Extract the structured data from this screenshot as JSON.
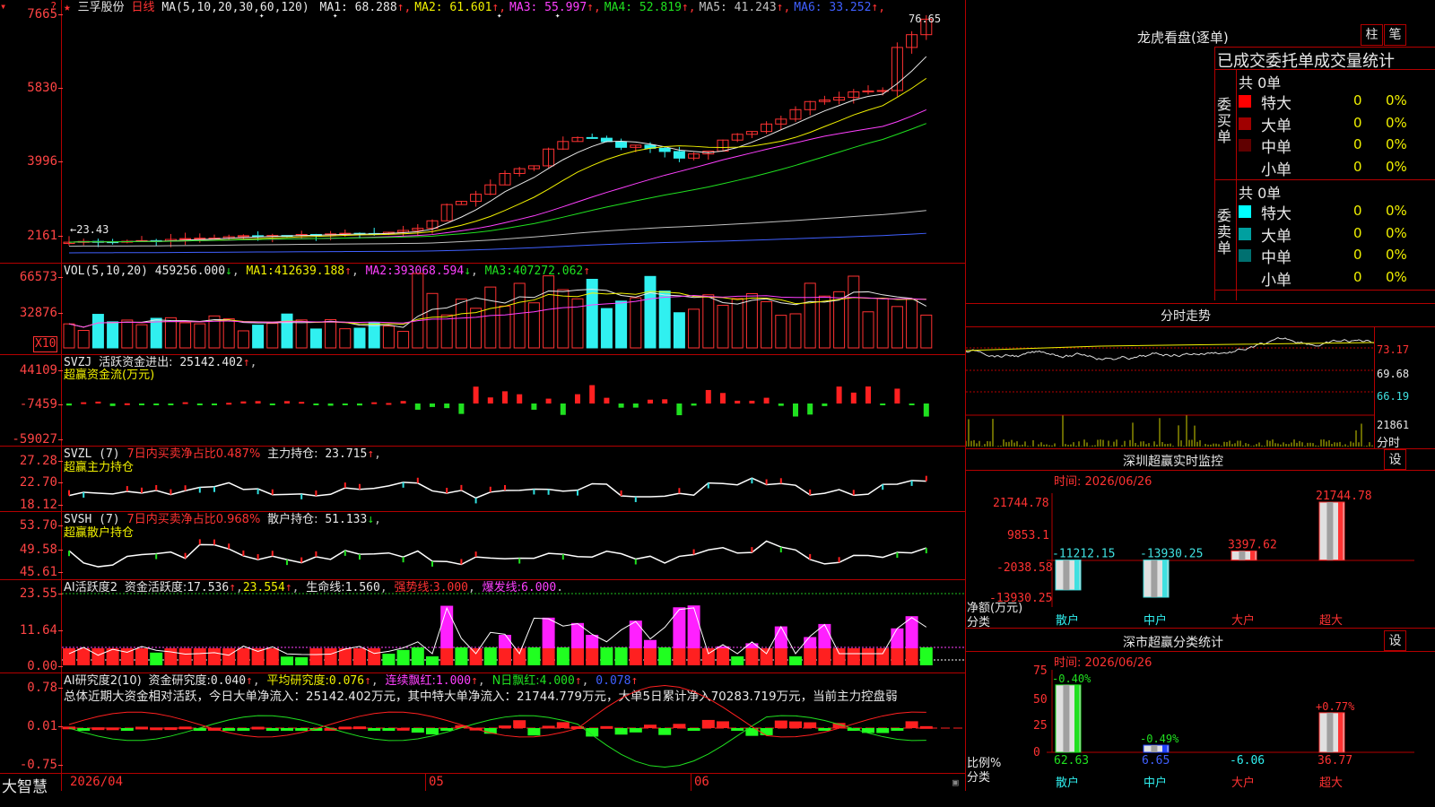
{
  "stock": {
    "name": "三孚股份",
    "period": "日线"
  },
  "main_ma": {
    "params": "MA(5,10,20,30,60,120)",
    "items": [
      {
        "label": "MA1:",
        "value": "68.288",
        "color": "#e8e8e8"
      },
      {
        "label": "MA2:",
        "value": "61.601",
        "color": "#f0f000"
      },
      {
        "label": "MA3:",
        "value": "55.997",
        "color": "#ff40ff"
      },
      {
        "label": "MA4:",
        "value": "52.819",
        "color": "#20e020"
      },
      {
        "label": "MA5:",
        "value": "41.243",
        "color": "#c0c0c0"
      },
      {
        "label": "MA6:",
        "value": "33.252",
        "color": "#4060ff"
      }
    ]
  },
  "price_axis": [
    "7665",
    "5830",
    "3996",
    "2161"
  ],
  "price_high_label": "76.65",
  "price_low_label": "23.43",
  "vol": {
    "header": "VOL(5,10,20)",
    "value": "459256.000",
    "ma1_label": "MA1:",
    "ma1": "412639.188",
    "ma2_label": "MA2:",
    "ma2": "393068.594",
    "ma3_label": "MA3:",
    "ma3": "407272.062",
    "axis": [
      "66573",
      "32876"
    ],
    "unit": "X10"
  },
  "svzj": {
    "name": "SVZJ",
    "label1": "活跃资金进出:",
    "value": "25142.402",
    "label2": "超赢资金流(万元)",
    "axis": [
      "44109",
      "-7459",
      "-59027"
    ]
  },
  "svzl": {
    "name": "SVZL",
    "param": "(7)",
    "label1": "7日内买卖净占比0.487%",
    "label2": "主力持仓:",
    "value": "23.715",
    "label3": "超赢主力持仓",
    "axis": [
      "27.28",
      "22.70",
      "18.12"
    ]
  },
  "svsh": {
    "name": "SVSH",
    "param": "(7)",
    "label1": "7日内买卖净占比0.968%",
    "label2": "散户持仓:",
    "value": "51.133",
    "label3": "超赢散户持仓",
    "axis": [
      "53.70",
      "49.58",
      "45.61"
    ]
  },
  "ai_active": {
    "name": "AI活跃度2",
    "label1": "资金活跃度:",
    "v1": "17.536",
    "v2": "23.554",
    "label2": "生命线:",
    "v3": "1.560",
    "label3": "强势线:",
    "v4": "3.000",
    "label4": "爆发线:",
    "v5": "6.000",
    "axis": [
      "23.55",
      "11.64",
      "0.00"
    ]
  },
  "ai_research": {
    "name": "AI研究度2(10)",
    "label1": "资金研究度:",
    "v1": "0.040",
    "label2": "平均研究度:",
    "v2": "0.076",
    "label3": "连续飘红:",
    "v3": "1.000",
    "label4": "N日飘红:",
    "v4": "4.000",
    "v5": "0.078",
    "summary": "总体近期大资金相对活跃，今日大单净流入：25142.402万元，其中特大单净流入：21744.779万元，大单5日累计净入70283.719万元，当前主力控盘弱",
    "axis": [
      "0.78",
      "0.01",
      "-0.75"
    ]
  },
  "date_axis": [
    "2026/04",
    "05",
    "06"
  ],
  "app_name": "大智慧",
  "dragon": {
    "title": "龙虎看盘(逐单)",
    "btn1": "柱",
    "btn2": "笔",
    "header": "已成交委托单成交量统计",
    "buy": {
      "side": "委买单",
      "total": "共 0单",
      "rows": [
        {
          "name": "特大",
          "count": "0",
          "pct": "0%",
          "color": "#ff0000"
        },
        {
          "name": "大单",
          "count": "0",
          "pct": "0%",
          "color": "#a00000"
        },
        {
          "name": "中单",
          "count": "0",
          "pct": "0%",
          "color": "#600000"
        },
        {
          "name": "小单",
          "count": "0",
          "pct": "0%",
          "color": "#000000"
        }
      ]
    },
    "sell": {
      "side": "委卖单",
      "total": "共 0单",
      "rows": [
        {
          "name": "特大",
          "count": "0",
          "pct": "0%",
          "color": "#00ffff"
        },
        {
          "name": "大单",
          "count": "0",
          "pct": "0%",
          "color": "#00a0a0"
        },
        {
          "name": "中单",
          "count": "0",
          "pct": "0%",
          "color": "#007070"
        },
        {
          "name": "小单",
          "count": "0",
          "pct": "0%",
          "color": "#000000"
        }
      ]
    }
  },
  "intraday": {
    "title": "分时走势",
    "axis": [
      "73.17",
      "69.68",
      "66.19"
    ],
    "vol_label": "21861",
    "tag": "分时"
  },
  "monitor": {
    "title": "深圳超赢实时监控",
    "btn": "设",
    "time": "时间: 2026/06/26",
    "axis": [
      "21744.78",
      "9853.1",
      "-2038.58",
      "-13930.25"
    ],
    "ylabel1": "净额(万元)",
    "ylabel2": "分类",
    "bars": [
      {
        "cat": "散户",
        "value": "-11212.15"
      },
      {
        "cat": "中户",
        "value": "-13930.25"
      },
      {
        "cat": "大户",
        "value": "3397.62"
      },
      {
        "cat": "超大",
        "value": "21744.78"
      }
    ]
  },
  "classify": {
    "title": "深市超赢分类统计",
    "btn": "设",
    "time": "时间: 2026/06/26",
    "axis": [
      "75",
      "50",
      "25",
      "0"
    ],
    "ylabel1": "比例%",
    "ylabel2": "分类",
    "bars": [
      {
        "cat": "散户",
        "change": "-0.40%",
        "value": "62.63"
      },
      {
        "cat": "中户",
        "change": "-0.49%",
        "value": "6.65"
      },
      {
        "cat": "大户",
        "change": "",
        "value": "-6.06"
      },
      {
        "cat": "超大",
        "change": "+0.77%",
        "value": "36.77"
      }
    ]
  }
}
